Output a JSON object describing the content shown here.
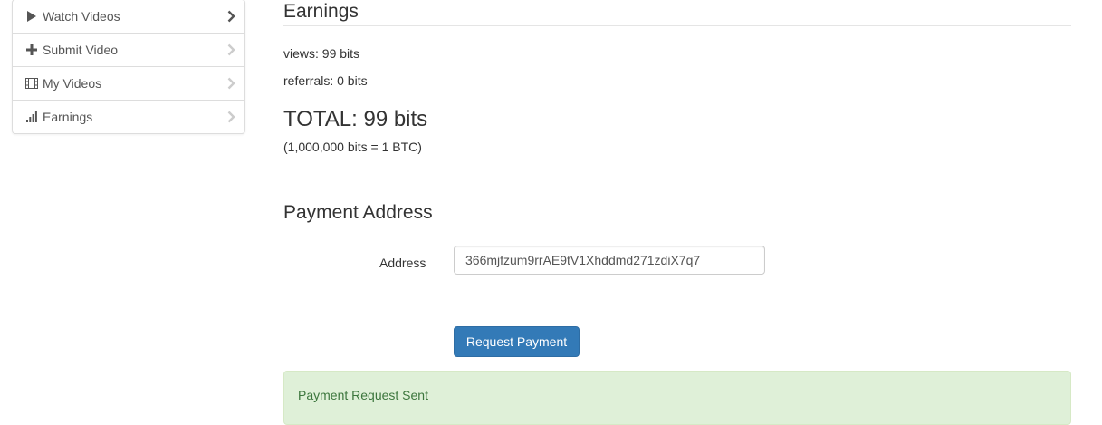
{
  "sidebar": {
    "items": [
      {
        "label": "Watch Videos",
        "icon": "play-icon"
      },
      {
        "label": "Submit Video",
        "icon": "plus-icon"
      },
      {
        "label": "My Videos",
        "icon": "film-icon"
      },
      {
        "label": "Earnings",
        "icon": "signal-bars-icon"
      }
    ]
  },
  "earnings": {
    "title": "Earnings",
    "views": "views: 99 bits",
    "referrals": "referrals: 0 bits",
    "total": "TOTAL: 99 bits",
    "conversion": "(1,000,000 bits = 1 BTC)"
  },
  "payment": {
    "title": "Payment Address",
    "address_label": "Address",
    "address_value": "366mjfzum9rrAE9tV1Xhddmd271zdiX7q7",
    "request_button": "Request Payment",
    "alert_text": "Payment Request Sent"
  },
  "colors": {
    "primary": "#337ab7",
    "success_bg": "#dff0d8",
    "success_text": "#3c763d"
  }
}
